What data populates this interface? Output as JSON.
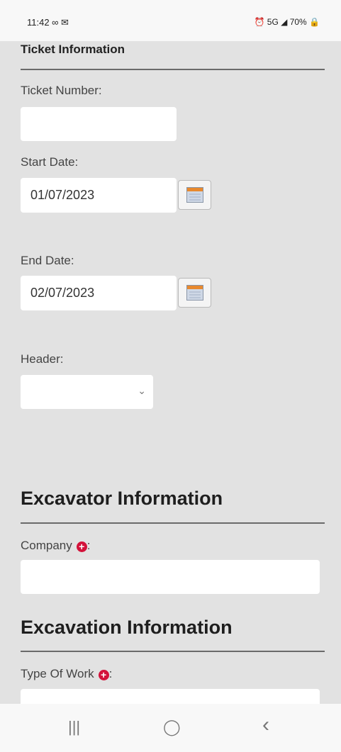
{
  "status_bar": {
    "time": "11:42 ∞ ✉",
    "right": "⏰ 5G ◢ 70% 🔒"
  },
  "ticket_section": {
    "title": "Ticket Information",
    "ticket_number_label": "Ticket Number:",
    "ticket_number_value": "",
    "start_date_label": "Start Date:",
    "start_date_value": "01/07/2023",
    "end_date_label": "End Date:",
    "end_date_value": "02/07/2023",
    "header_label": "Header:",
    "header_value": ""
  },
  "excavator_section": {
    "title": "Excavator Information",
    "company_label": "Company",
    "company_suffix": ":",
    "company_value": ""
  },
  "excavation_section": {
    "title": "Excavation Information",
    "type_of_work_label": "Type Of Work",
    "type_of_work_suffix": ":",
    "type_of_work_value": ""
  },
  "colors": {
    "background": "#e2e2e2",
    "required_icon": "#d3123a",
    "calendar_header": "#e8892e",
    "calendar_body": "#cfd8e6"
  },
  "icons": {
    "calendar": "calendar-icon",
    "required": "plus-circle-icon",
    "chevron": "chevron-down-icon"
  },
  "nav_bar": {
    "recent": "|||",
    "home": "◯",
    "back": "‹"
  }
}
